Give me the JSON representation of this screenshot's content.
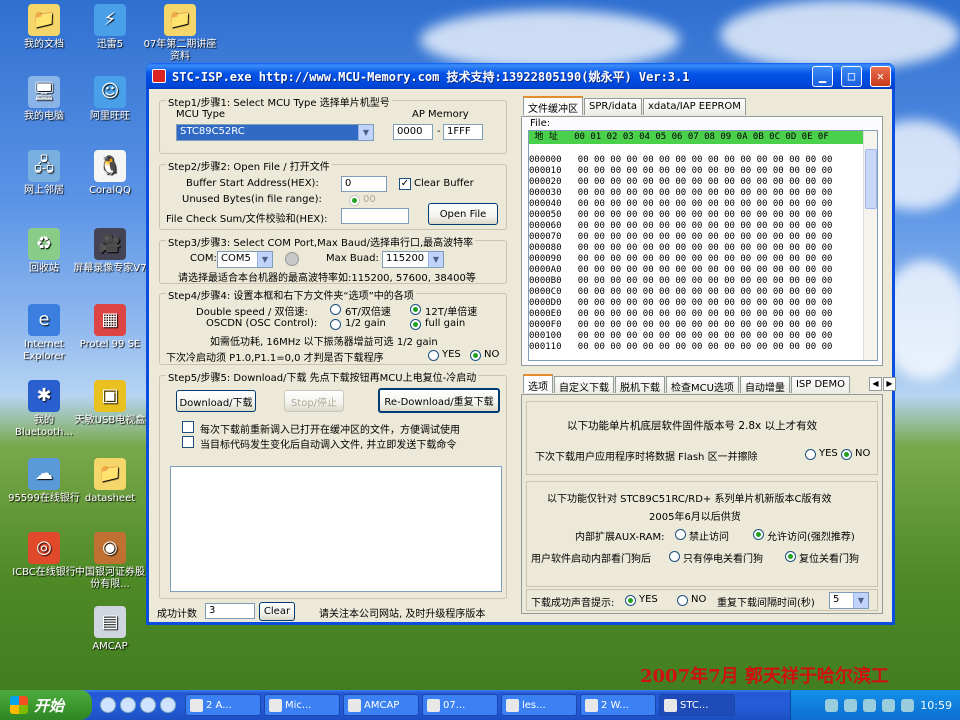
{
  "desktop": {
    "icons": [
      {
        "label": "我的文档",
        "glyph": "📁"
      },
      {
        "label": "迅雷5",
        "glyph": "⚡"
      },
      {
        "label": "07年第二期讲座资料",
        "glyph": "📁"
      },
      {
        "label": "我的电脑",
        "glyph": "🖥"
      },
      {
        "label": "阿里旺旺",
        "glyph": "☺"
      },
      {
        "label": "网上邻居",
        "glyph": "🖧"
      },
      {
        "label": "CoralQQ",
        "glyph": "🐧"
      },
      {
        "label": "回收站",
        "glyph": "♻"
      },
      {
        "label": "屏幕录像专家V7",
        "glyph": "🎥"
      },
      {
        "label": "Internet Explorer",
        "glyph": "e"
      },
      {
        "label": "Protel 99 SE",
        "glyph": "▦"
      },
      {
        "label": "我的Bluetooth...",
        "glyph": "✱"
      },
      {
        "label": "天敏USB电视盒",
        "glyph": "▣"
      },
      {
        "label": "95599在线银行",
        "glyph": "☁"
      },
      {
        "label": "datasheet",
        "glyph": "📁"
      },
      {
        "label": "ICBC在线银行",
        "glyph": "◎"
      },
      {
        "label": "中国银河证券股份有限...",
        "glyph": "◉"
      },
      {
        "label": "AMCAP",
        "glyph": "▤"
      }
    ],
    "watermark": "2007年7月  郭天祥于哈尔滨工"
  },
  "window": {
    "title": "STC-ISP.exe http://www.MCU-Memory.com 技术支持:13922805190(姚永平) Ver:3.1",
    "step1": {
      "legend": "Step1/步骤1: Select MCU Type  选择单片机型号",
      "mcu_type_label": "MCU Type",
      "ap_memory_label": "AP Memory",
      "mcu_value": "STC89C52RC",
      "ap_from": "0000",
      "ap_dash": "-",
      "ap_to": "1FFF"
    },
    "step2": {
      "legend": "Step2/步骤2: Open File / 打开文件",
      "buffer_label": "Buffer Start Address(HEX):",
      "buffer_value": "0",
      "clear_buffer": "Clear Buffer",
      "unused_label": "Unused Bytes(in file range):",
      "unused_value": "00",
      "checksum_label": "File Check Sum/文件校验和(HEX):",
      "open_file": "Open File"
    },
    "step3": {
      "legend": "Step3/步骤3: Select COM Port,Max Baud/选择串行口,最高波特率",
      "com_label": "COM:",
      "com_value": "COM5",
      "baud_label": "Max Buad:",
      "baud_value": "115200",
      "hint": "请选择最适合本台机器的最高波特率如:115200, 57600, 38400等"
    },
    "step4": {
      "legend": "Step4/步骤4: 设置本框和右下方文件夹“选项”中的各项",
      "double_speed_label": "Double speed / 双倍速:",
      "opt_6t": "6T/双倍速",
      "opt_12t": "12T/单倍速",
      "oscdn_label": "OSCDN (OSC Control):",
      "opt_half": "1/2 gain",
      "opt_full": "full gain",
      "note": "如需低功耗, 16MHz 以下振荡器增益可选 1/2 gain",
      "cold_start_label": "下次冷启动须 P1.0,P1.1=0,0 才判是否下载程序",
      "yes": "YES",
      "no": "NO"
    },
    "step5": {
      "legend": "Step5/步骤5: Download/下载  先点下载按钮再MCU上电复位-冷启动",
      "download": "Download/下载",
      "stop": "Stop/停止",
      "redownload": "Re-Download/重复下载",
      "check1": "每次下载前重新调入已打开在缓冲区的文件，方便调试使用",
      "check2": "当目标代码发生变化后自动调入文件, 并立即发送下载命令"
    },
    "footer": {
      "count_label": "成功计数",
      "count_value": "3",
      "clear": "Clear",
      "notice": "请关注本公司网站, 及时升级程序版本"
    },
    "hex_tabs": [
      "文件缓冲区",
      "SPR/idata",
      "xdata/IAP EEPROM"
    ],
    "hex": {
      "file_label": "File:",
      "header": " 地 址   00 01 02 03 04 05 06 07 08 09 0A 0B 0C 0D 0E 0F",
      "rows": [
        "000000",
        "000010",
        "000020",
        "000030",
        "000040",
        "000050",
        "000060",
        "000070",
        "000080",
        "000090",
        "0000A0",
        "0000B0",
        "0000C0",
        "0000D0",
        "0000E0",
        "0000F0",
        "000100",
        "000110"
      ],
      "cells": "00 00 00 00 00 00 00 00 00 00 00 00 00 00 00 00"
    },
    "opt_tabs": [
      "选项",
      "自定义下载",
      "脱机下载",
      "检查MCU选项",
      "自动增量",
      "ISP DEMO"
    ],
    "options": {
      "firmware_note": "以下功能单片机底层软件固件版本号 2.8x 以上才有效",
      "erase_label": "下次下载用户应用程序时将数据 Flash 区一并擦除",
      "yes": "YES",
      "no": "NO",
      "rd_note": "以下功能仅针对 STC89C51RC/RD+ 系列单片机新版本C版有效",
      "date_note": "2005年6月以后供货",
      "auxram_label": "内部扩展AUX-RAM:",
      "auxram_off": "禁止访问",
      "auxram_on": "允许访问(强烈推荐)",
      "watchdog_label": "用户软件启动内部看门狗后",
      "wd_opt1": "只有停电关看门狗",
      "wd_opt2": "复位关看门狗",
      "sound_label": "下载成功声音提示:",
      "sound_yes": "YES",
      "sound_no": "NO",
      "interval_label": "重复下载间隔时间(秒)",
      "interval_value": "5"
    }
  },
  "taskbar": {
    "start": "开始",
    "tasks": [
      "2 A...",
      "Mic...",
      "AMCAP",
      "07...",
      "les...",
      "2 W...",
      "STC..."
    ],
    "clock": "10:59"
  }
}
